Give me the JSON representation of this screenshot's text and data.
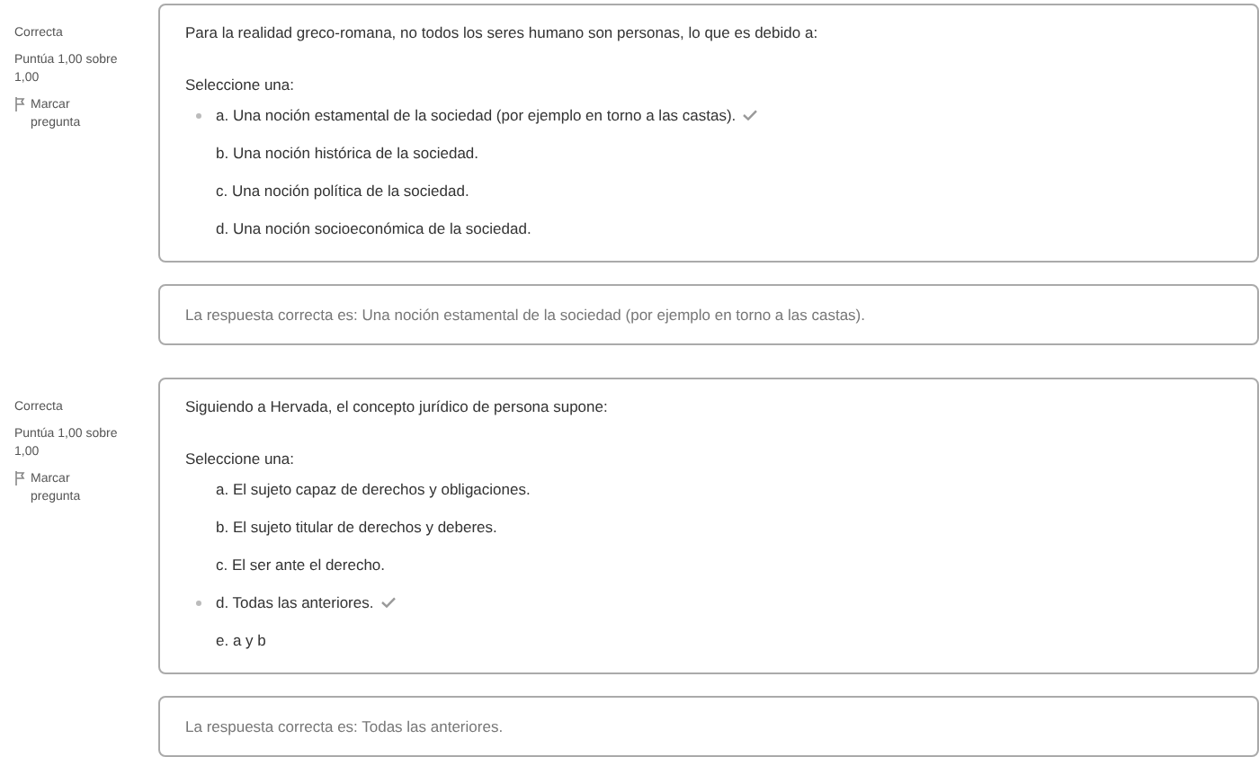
{
  "questions": [
    {
      "status": "Correcta",
      "score": "Puntúa 1,00 sobre 1,00",
      "flag": "Marcar pregunta",
      "text": "Para la realidad greco-romana, no todos los seres humano son personas, lo que es debido a:",
      "prompt": "Seleccione una:",
      "options": [
        {
          "label": "a. Una noción estamental de la sociedad (por ejemplo en torno a las castas).",
          "selected": true,
          "correct": true
        },
        {
          "label": "b. Una noción histórica de la sociedad.",
          "selected": false,
          "correct": false
        },
        {
          "label": "c. Una noción política de la sociedad.",
          "selected": false,
          "correct": false
        },
        {
          "label": "d. Una noción socioeconómica de la sociedad.",
          "selected": false,
          "correct": false
        }
      ],
      "feedback": "La respuesta correcta es: Una noción estamental de la sociedad (por ejemplo en torno a las castas)."
    },
    {
      "status": "Correcta",
      "score": "Puntúa 1,00 sobre 1,00",
      "flag": "Marcar pregunta",
      "text": "Siguiendo a Hervada, el concepto jurídico de persona supone:",
      "prompt": "Seleccione una:",
      "options": [
        {
          "label": "a. El sujeto capaz de derechos y obligaciones.",
          "selected": false,
          "correct": false
        },
        {
          "label": "b. El sujeto titular de derechos y deberes.",
          "selected": false,
          "correct": false
        },
        {
          "label": "c. El ser ante el derecho.",
          "selected": false,
          "correct": false
        },
        {
          "label": "d. Todas las anteriores.",
          "selected": true,
          "correct": true
        },
        {
          "label": "e. a y b",
          "selected": false,
          "correct": false
        }
      ],
      "feedback": "La respuesta correcta es: Todas las anteriores."
    }
  ]
}
